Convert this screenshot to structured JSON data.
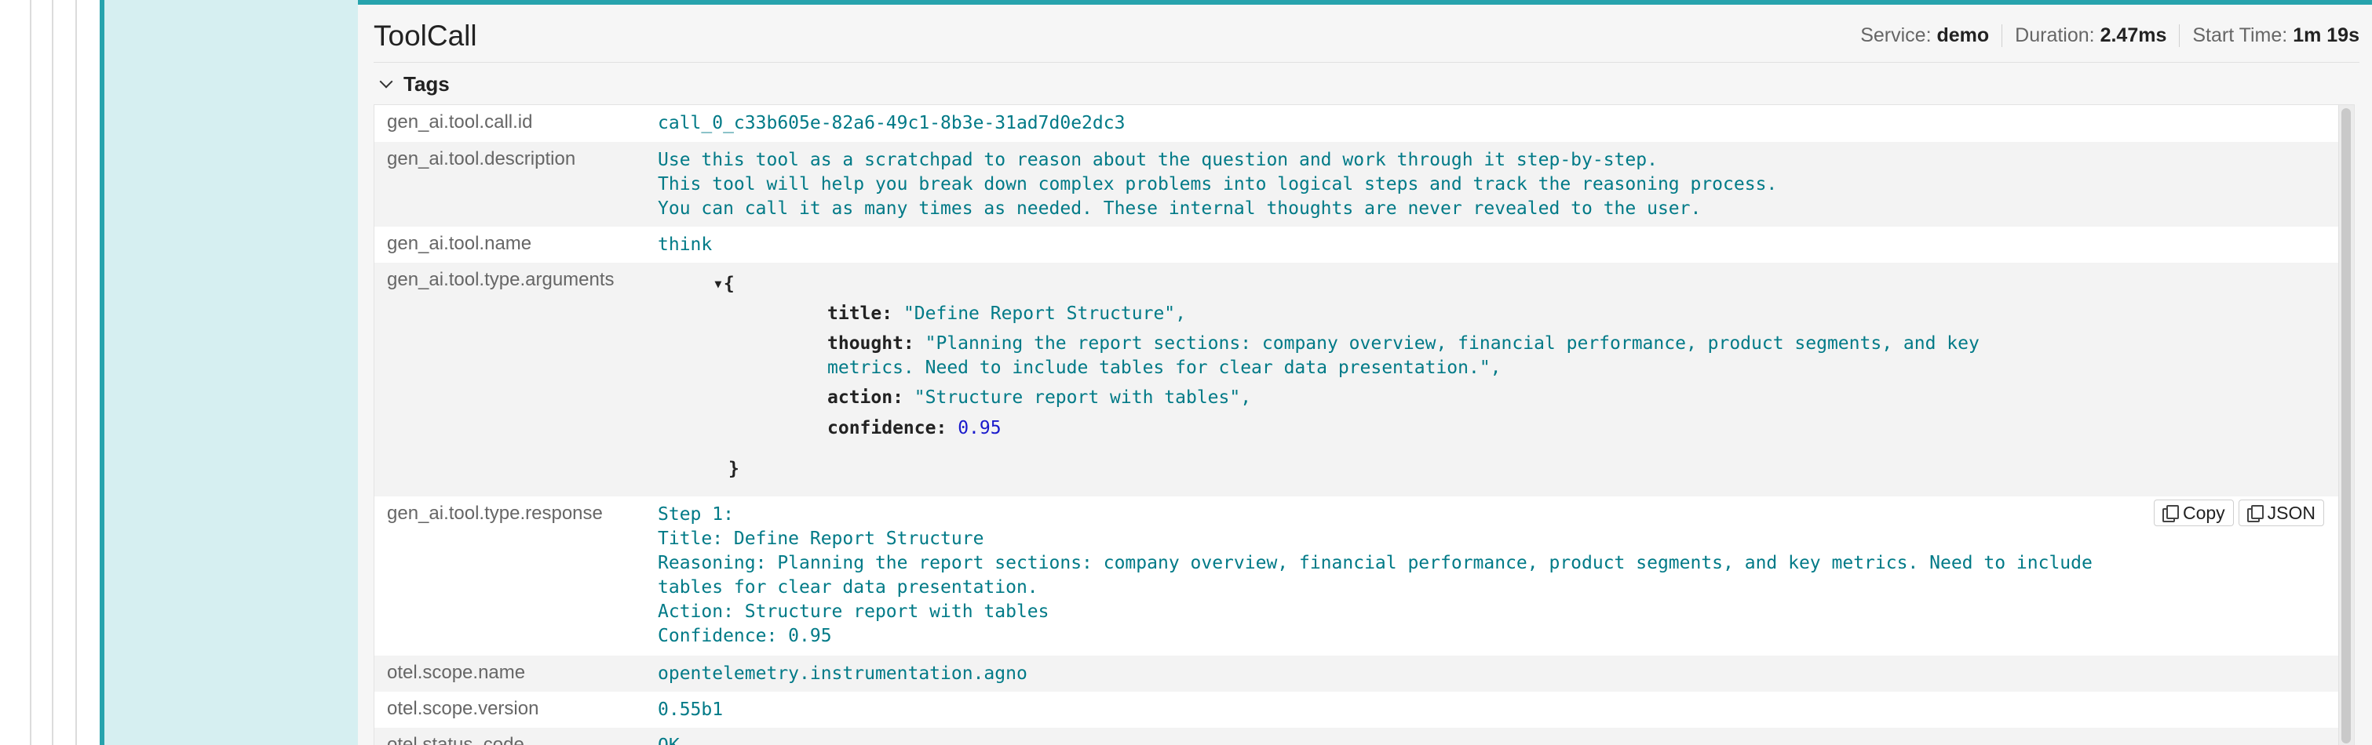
{
  "header": {
    "title": "ToolCall",
    "service_label": "Service:",
    "service_value": "demo",
    "duration_label": "Duration:",
    "duration_value": "2.47ms",
    "start_label": "Start Time:",
    "start_value": "1m 19s"
  },
  "tags": {
    "section_label": "Tags",
    "rows": [
      {
        "key": "gen_ai.tool.call.id",
        "value": "call_0_c33b605e-82a6-49c1-8b3e-31ad7d0e2dc3"
      },
      {
        "key": "gen_ai.tool.description",
        "value": "Use this tool as a scratchpad to reason about the question and work through it step-by-step.\nThis tool will help you break down complex problems into logical steps and track the reasoning process.\nYou can call it as many times as needed. These internal thoughts are never revealed to the user."
      },
      {
        "key": "gen_ai.tool.name",
        "value": "think"
      },
      {
        "key": "gen_ai.tool.type.arguments",
        "value": ""
      },
      {
        "key": "gen_ai.tool.type.response",
        "value": "Step 1:\nTitle: Define Report Structure\nReasoning: Planning the report sections: company overview, financial performance, product segments, and key metrics. Need to include\ntables for clear data presentation.\nAction: Structure report with tables\nConfidence: 0.95"
      },
      {
        "key": "otel.scope.name",
        "value": "opentelemetry.instrumentation.agno"
      },
      {
        "key": "otel.scope.version",
        "value": "0.55b1"
      },
      {
        "key": "otel.status_code",
        "value": "OK"
      }
    ]
  },
  "arguments_json": {
    "open": "▾{",
    "close": "}",
    "title_key": "title:",
    "title_val": "\"Define Report Structure\",",
    "thought_key": "thought:",
    "thought_val_1": "\"Planning the report sections: company overview, financial performance, product segments, and key",
    "thought_val_2": "metrics. Need to include tables for clear data presentation.\",",
    "action_key": "action:",
    "action_val": "\"Structure report with tables\",",
    "confidence_key": "confidence:",
    "confidence_val": "0.95"
  },
  "buttons": {
    "copy": "Copy",
    "json": "JSON"
  },
  "colors": {
    "accent": "#27a3ad",
    "value_text": "#007a87",
    "number": "#1a1acc"
  }
}
